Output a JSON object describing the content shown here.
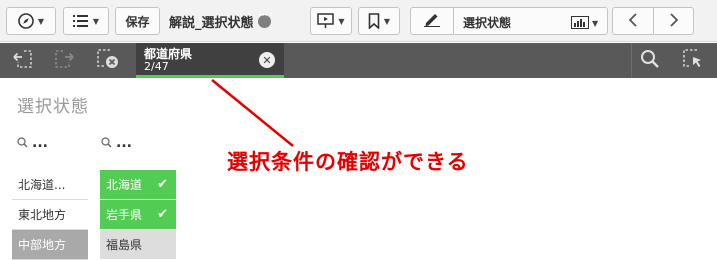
{
  "toolbar": {
    "compass_icon": "compass-icon",
    "list_icon": "list-icon",
    "save_label": "保存",
    "app_title": "解説_選択状態",
    "present_icon": "present-icon",
    "bookmark_icon": "bookmark-icon",
    "edit_icon": "pencil-icon",
    "sheet_name": "選択状態",
    "prev_icon": "chevron-left-icon",
    "next_icon": "chevron-right-icon"
  },
  "selections": {
    "field": "都道府県",
    "count": "2/47"
  },
  "sheet": {
    "title": "選択状態"
  },
  "listbox_region": {
    "search_text": "...",
    "items": [
      "北海道...",
      "東北地方",
      "中部地方"
    ]
  },
  "listbox_pref": {
    "search_text": "...",
    "items": [
      {
        "label": "北海道",
        "state": "selected"
      },
      {
        "label": "岩手県",
        "state": "selected"
      },
      {
        "label": "福島県",
        "state": "alternative"
      }
    ]
  },
  "annotation": {
    "text": "選択条件の確認ができる",
    "color": "#e60000"
  },
  "colors": {
    "selected_green": "#52cc52",
    "selection_bar": "#595959",
    "excluded_gray": "#a9a9a9"
  }
}
